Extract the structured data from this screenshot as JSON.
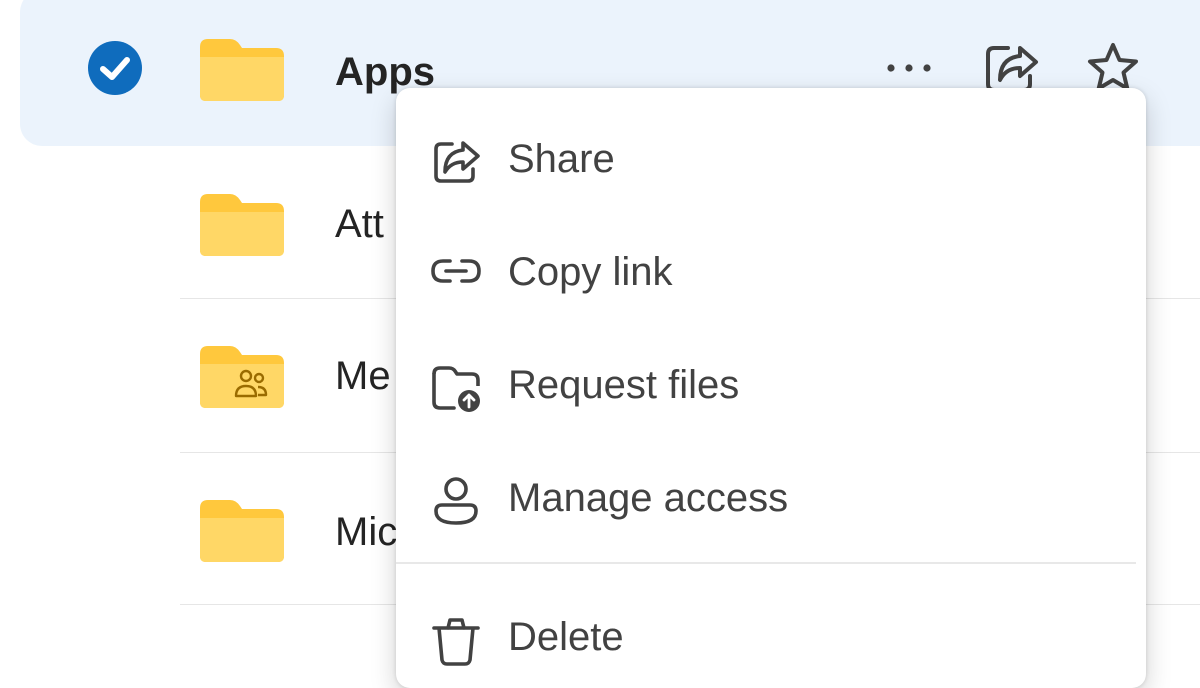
{
  "files": [
    {
      "name": "Apps",
      "selected": true,
      "shared": false
    },
    {
      "name": "Att",
      "selected": false,
      "shared": false
    },
    {
      "name": "Me",
      "selected": false,
      "shared": true
    },
    {
      "name": "Mic",
      "selected": false,
      "shared": false
    }
  ],
  "row_actions": {
    "more_icon": "more-horizontal-icon",
    "share_icon": "share-icon",
    "favorite_icon": "star-icon"
  },
  "context_menu": {
    "items": [
      {
        "label": "Share",
        "icon": "share-icon"
      },
      {
        "label": "Copy link",
        "icon": "link-icon"
      },
      {
        "label": "Request files",
        "icon": "folder-request-icon"
      },
      {
        "label": "Manage access",
        "icon": "person-icon"
      },
      {
        "label": "Delete",
        "icon": "trash-icon"
      }
    ]
  },
  "colors": {
    "accent": "#0f6cbd",
    "selection": "#ebf3fc",
    "folder": "#ffc83d"
  }
}
